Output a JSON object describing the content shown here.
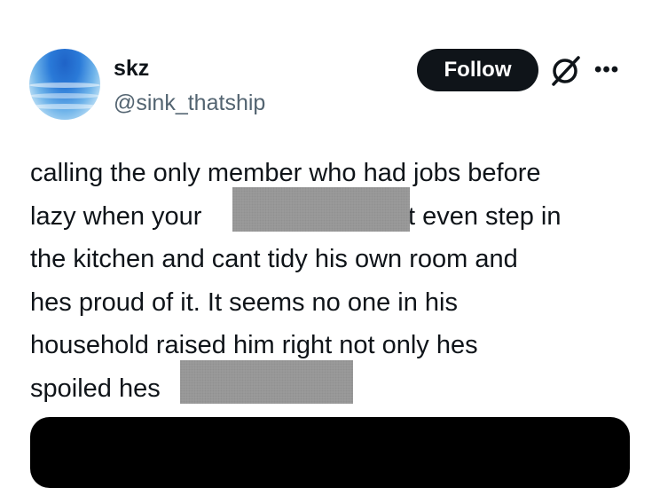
{
  "tweet": {
    "author": {
      "display_name": "skz",
      "handle": "@sink_thatship"
    },
    "actions": {
      "follow_label": "Follow",
      "grok_icon": "grok-icon",
      "more_icon": "more-icon",
      "more_glyph": "•••"
    },
    "text_lines": [
      "calling the only member who had jobs before",
      "lazy when your",
      "t even step in",
      "the kitchen and cant tidy his own room and",
      "hes proud of it. It seems no one in his",
      "household raised him right not only hes",
      "spoiled hes"
    ],
    "redaction_color": "#9a9a9a",
    "media_color": "#000000"
  }
}
